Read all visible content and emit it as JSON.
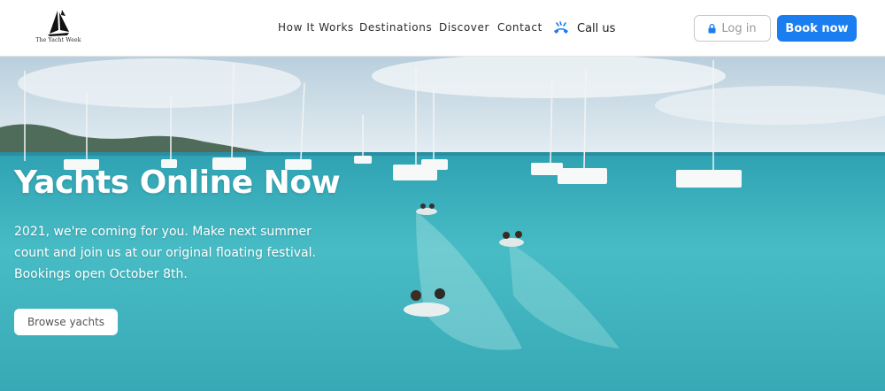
{
  "brand": {
    "name": "The Yacht Week",
    "logo_icon": "sail-logo-icon"
  },
  "nav": {
    "items": [
      {
        "label": "How It Works"
      },
      {
        "label": "Destinations"
      },
      {
        "label": "Discover"
      },
      {
        "label": "Contact"
      }
    ],
    "call": {
      "label": "Call us",
      "icon": "phone-wave-icon"
    }
  },
  "actions": {
    "login_label": "Log in",
    "login_icon": "lock-icon",
    "book_label": "Book now"
  },
  "hero": {
    "title": "Yachts Online Now",
    "subtitle_lines": [
      "2021, we're coming for you. Make next summer",
      "count and join us at our original floating festival.",
      "Bookings open October 8th."
    ],
    "cta_label": "Browse yachts"
  },
  "colors": {
    "accent": "#1a7df0",
    "header_bg": "#ffffff",
    "water": "#3fb4c0"
  }
}
